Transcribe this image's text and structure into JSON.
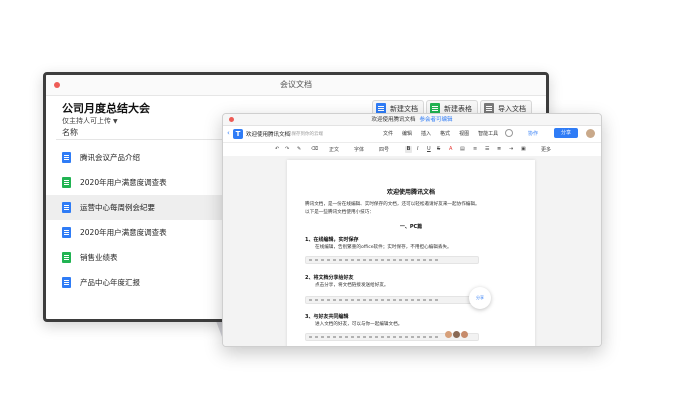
{
  "back_window": {
    "title": "会议文档",
    "folder_title": "公司月度总结大会",
    "folder_permission": "仅主持人可上传",
    "buttons": {
      "new_doc": "新建文档",
      "new_sheet": "新建表格",
      "import": "导入文档"
    },
    "list_header": "名称",
    "files": [
      {
        "name": "腾讯会议产品介绍",
        "type": "doc-icon"
      },
      {
        "name": "2020年用户满意度调查表",
        "type": "sheet-icon"
      },
      {
        "name": "运营中心每周例会纪要",
        "type": "doc-icon"
      },
      {
        "name": "2020年用户满意度调查表",
        "type": "doc-icon"
      },
      {
        "name": "销售业绩表",
        "type": "sheet-icon"
      },
      {
        "name": "产品中心年度汇报",
        "type": "doc-icon"
      }
    ],
    "selected_index": 2
  },
  "front_window": {
    "title": "欢迎使用腾讯文档",
    "permission": "参会者可编辑",
    "doc_name": "欢迎使用腾讯文档",
    "saved_status": "已保存到你的云端",
    "menu": [
      "文件",
      "编辑",
      "插入",
      "格式",
      "视图",
      "智能工具"
    ],
    "collab_label": "协作",
    "share_label": "分享",
    "toolbar": {
      "style": "正文",
      "font": "字体",
      "size": "四号",
      "bold": "B",
      "italic": "I",
      "underline": "U",
      "strike": "S",
      "color": "A",
      "more": "更多"
    },
    "document": {
      "heading": "欢迎使用腾讯文档",
      "intro_1": "腾讯文档，是一份在线编辑、实时保存的文档，还可以轻松邀请好友来一起协作编辑。",
      "intro_2": "以下是一些腾讯文档使用小技巧：",
      "section": "一、PC篇",
      "item1_title": "1、在线编辑，实时保存",
      "item1_text": "在线编辑，告别繁重的office软件；实时保存，不用担心编辑丢失。",
      "item2_title": "2、将文档分享给好友",
      "item2_text": "点击分享，将文档链接发送给好友。",
      "item2_bubble": "分享",
      "item3_title": "3、与好友共同编辑",
      "item3_text": "进入文档的好友，可以与你一起编辑文档。"
    }
  },
  "colors": {
    "accent": "#2f7cf6",
    "doc_icon": "#2f7cf6",
    "sheet_icon": "#21b352",
    "window_border": "#3d3d3d"
  }
}
